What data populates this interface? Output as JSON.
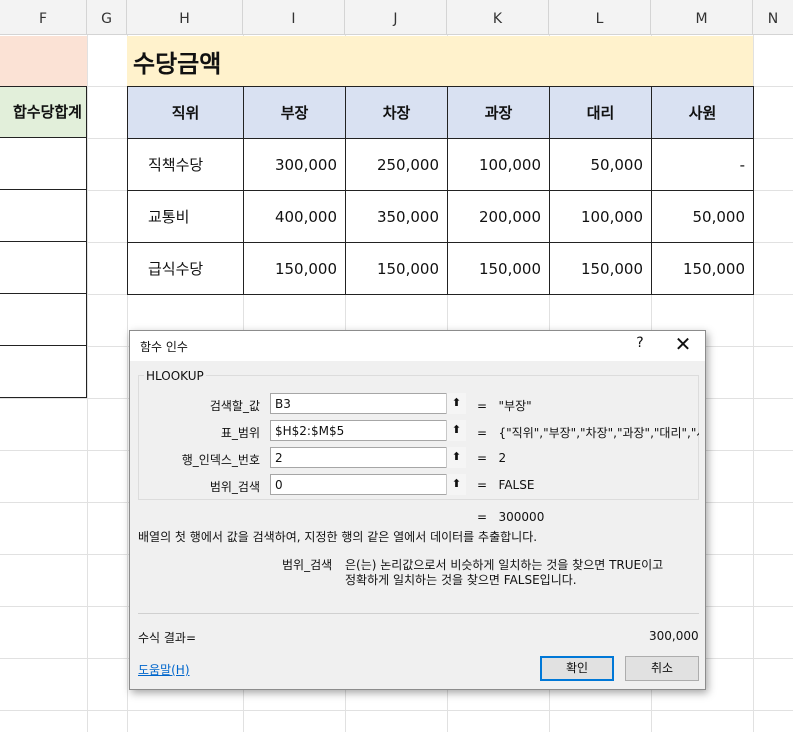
{
  "sheet": {
    "columns": [
      "F",
      "G",
      "H",
      "I",
      "J",
      "K",
      "L",
      "M",
      "N"
    ],
    "f_header": "합수당합계",
    "title": "수당금액",
    "table": {
      "header": [
        "직위",
        "부장",
        "차장",
        "과장",
        "대리",
        "사원"
      ],
      "rows": [
        [
          "직책수당",
          "300,000",
          "250,000",
          "100,000",
          "50,000",
          "-"
        ],
        [
          "교통비",
          "400,000",
          "350,000",
          "200,000",
          "100,000",
          "50,000"
        ],
        [
          "급식수당",
          "150,000",
          "150,000",
          "150,000",
          "150,000",
          "150,000"
        ]
      ]
    }
  },
  "dialog": {
    "title": "함수 인수",
    "help_glyph": "?",
    "close_glyph": "✕",
    "function_name": "HLOOKUP",
    "args": [
      {
        "label": "검색할_값",
        "value": "B3",
        "result": "\"부장\""
      },
      {
        "label": "표_범위",
        "value": "$H$2:$M$5",
        "result": "{\"직위\",\"부장\",\"차장\",\"과장\",\"대리\",\"사원\""
      },
      {
        "label": "행_인덱스_번호",
        "value": "2",
        "result": "2"
      },
      {
        "label": "범위_검색",
        "value": "0",
        "result": "FALSE"
      }
    ],
    "equals": "=",
    "ref_glyph": "⬆",
    "overall_result": "300000",
    "description": "배열의 첫 행에서 값을 검색하여, 지정한 행의 같은 열에서 데이터를 추출합니다.",
    "arg_help_name": "범위_검색",
    "arg_help_line1": "은(는) 논리값으로서 비슷하게 일치하는 것을 찾으면 TRUE이고",
    "arg_help_line2": "정확하게 일치하는 것을 찾으면 FALSE입니다.",
    "formula_result_label": "수식 결과=",
    "formula_result_value": "300,000",
    "help_link": "도움말(H)",
    "ok_label": "확인",
    "cancel_label": "취소"
  }
}
